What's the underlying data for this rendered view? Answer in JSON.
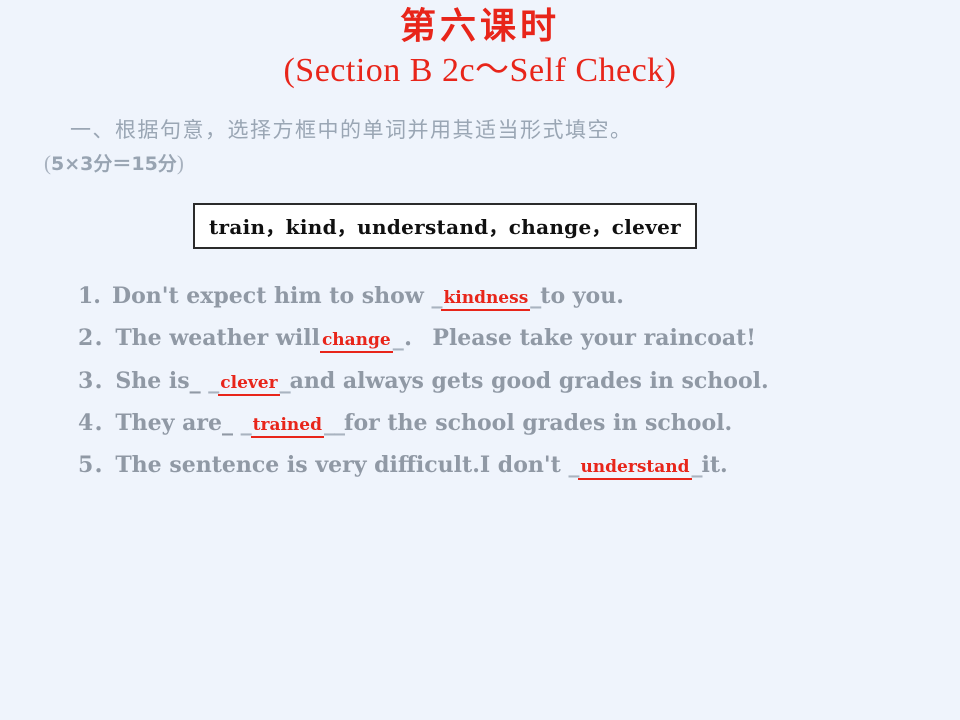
{
  "slide": {
    "background_color": "#eff4fc",
    "title": {
      "line1": "第六课时",
      "line2": "(Section B 2c～Self Check)",
      "color": "#e8251a"
    },
    "instruction": {
      "line1": "一、根据句意，选择方框中的单词并用其适当形式填空。",
      "score_open_paren": "(",
      "score_text": "5×3分＝15分",
      "score_close_paren": ")",
      "color": "#9aa6b4"
    },
    "word_bank": {
      "text": "train，kind，understand，change，clever",
      "words": [
        "train",
        "kind",
        "understand",
        "change",
        "clever"
      ],
      "separator": "，",
      "border_color": "#2b2b2b",
      "fill_color": "#ffffff"
    },
    "questions": [
      {
        "number": "1.",
        "before": "Don't expect him to show",
        "lead_underscore": "_",
        "answer": "kindness",
        "trail_underscore": "_",
        "after": "to you."
      },
      {
        "number": "2．",
        "before": "The weather will",
        "lead_underscore": "",
        "answer": "change",
        "trail_underscore": "_",
        "after": "．  Please take your raincoat!"
      },
      {
        "number": "3．",
        "before": "She is_",
        "lead_underscore": "_",
        "answer": "clever",
        "trail_underscore": "_",
        "after": "and always gets good grades in school."
      },
      {
        "number": "4．",
        "before": "They are_",
        "lead_underscore": "_",
        "answer": "trained",
        "trail_underscore": "__",
        "after": "for the school grades in school."
      },
      {
        "number": "5．",
        "before": "The sentence is very difficult.I don't",
        "lead_underscore": "_",
        "answer": "understand",
        "trail_underscore": "_",
        "after": "it."
      }
    ],
    "answer_color": "#e8251a",
    "question_text_color": "#9099a5"
  }
}
